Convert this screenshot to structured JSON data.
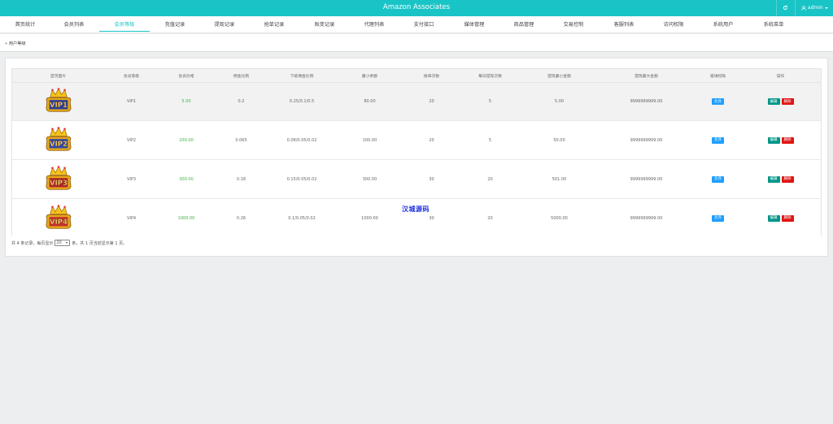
{
  "app": {
    "title": "Amazon Associates",
    "user": "admin",
    "refresh_icon": "refresh-icon",
    "user_icon": "user-icon"
  },
  "nav": [
    {
      "label": "首页统计"
    },
    {
      "label": "会员列表"
    },
    {
      "label": "会员等级",
      "active": true
    },
    {
      "label": "充值记录"
    },
    {
      "label": "提现记录"
    },
    {
      "label": "抢单记录"
    },
    {
      "label": "账变记录"
    },
    {
      "label": "代理列表"
    },
    {
      "label": "支付接口"
    },
    {
      "label": "媒体管理"
    },
    {
      "label": "商品管理"
    },
    {
      "label": "交易控制"
    },
    {
      "label": "客服列表"
    },
    {
      "label": "访问权限"
    },
    {
      "label": "系统用户"
    },
    {
      "label": "系统菜单"
    }
  ],
  "breadcrumb": "用户等级",
  "table": {
    "headers": [
      "首页图片",
      "会员等级",
      "会员价格",
      "佣金比例",
      "下级佣金比例",
      "最小余额",
      "接单次数",
      "每日提现次数",
      "提现最小金额",
      "提现最大金额",
      "邀请权限",
      "操作"
    ],
    "rows": [
      {
        "level": "VIP1",
        "badge_text": "VIP1",
        "price": "5.00",
        "commission": "0.2",
        "sub_commission": "0.25/0.1/0.5",
        "min_balance": "80.00",
        "orders": "20",
        "daily_withdraw": "5",
        "min_withdraw": "5.00",
        "max_withdraw": "9999999999.00",
        "invite": "允许",
        "edit": "编辑",
        "delete": "删除"
      },
      {
        "level": "VIP2",
        "badge_text": "VIP2",
        "price": "200.00",
        "commission": "0.065",
        "sub_commission": "0.08/0.05/0.02",
        "min_balance": "100.00",
        "orders": "20",
        "daily_withdraw": "5",
        "min_withdraw": "50.00",
        "max_withdraw": "9999999999.00",
        "invite": "允许",
        "edit": "编辑",
        "delete": "删除"
      },
      {
        "level": "VIP3",
        "badge_text": "VIP3",
        "price": "300.00",
        "commission": "0.18",
        "sub_commission": "0.15/0.05/0.02",
        "min_balance": "300.00",
        "orders": "30",
        "daily_withdraw": "20",
        "min_withdraw": "501.00",
        "max_withdraw": "9999999999.00",
        "invite": "允许",
        "edit": "编辑",
        "delete": "删除"
      },
      {
        "level": "VIP4",
        "badge_text": "VIP4",
        "price": "1000.00",
        "commission": "0.26",
        "sub_commission": "0.1/0.05/0.02",
        "min_balance": "1000.00",
        "orders": "30",
        "daily_withdraw": "20",
        "min_withdraw": "5000.00",
        "max_withdraw": "9999999999.00",
        "invite": "允许",
        "edit": "编辑",
        "delete": "删除"
      }
    ]
  },
  "pagination": {
    "prefix": "共 4 条记录，每页显示",
    "per_page": "20",
    "suffix": "条，共 1 页当前显示第 1 页。"
  },
  "watermark": "汉城源码",
  "colors": {
    "accent": "#19c4c6",
    "price": "#3eb53e",
    "allow_badge": "#1e9fff",
    "edit_badge": "#009688",
    "delete_badge": "#e01414"
  }
}
